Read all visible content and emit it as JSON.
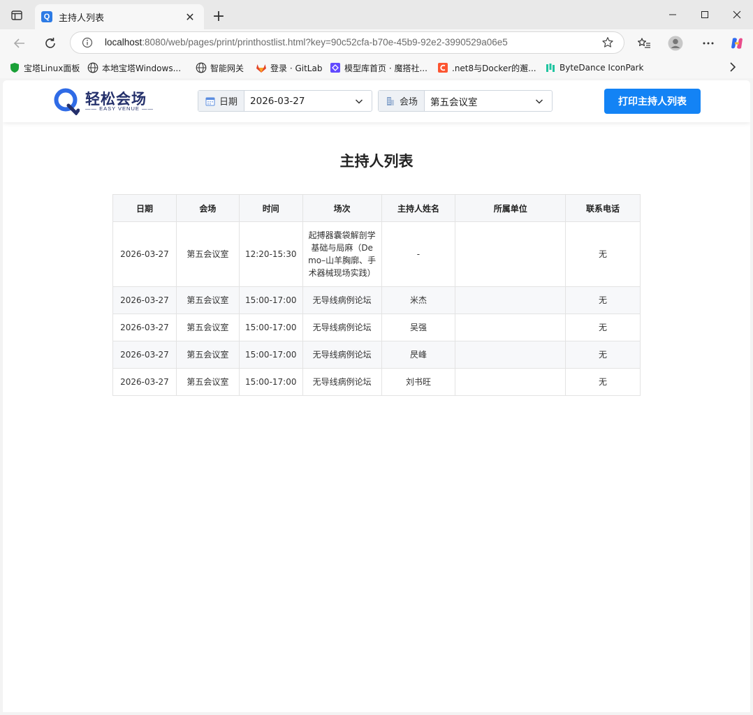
{
  "browser": {
    "tab_title": "主持人列表",
    "url_host": "localhost",
    "url_rest": ":8080/web/pages/print/printhostlist.html?key=90c52cfa-b70e-45b9-92e2-3990529a06e5",
    "bookmarks": [
      {
        "label": "宝塔Linux面板",
        "icon": "shield-icon"
      },
      {
        "label": "本地宝塔Windows...",
        "icon": "globe-icon"
      },
      {
        "label": "智能网关",
        "icon": "globe-icon"
      },
      {
        "label": "登录 · GitLab",
        "icon": "gitlab-icon"
      },
      {
        "label": "模型库首页 · 魔搭社...",
        "icon": "modelscope-icon"
      },
      {
        "label": ".net8与Docker的邂...",
        "icon": "csdn-icon"
      },
      {
        "label": "ByteDance IconPark",
        "icon": "iconpark-icon"
      }
    ]
  },
  "app": {
    "logo_text": "轻松会场",
    "logo_sub": "EASY VENUE",
    "date_label": "日期",
    "date_value": "2026-03-27",
    "venue_label": "会场",
    "venue_value": "第五会议室",
    "print_button": "打印主持人列表",
    "page_title": "主持人列表"
  },
  "table": {
    "headers": [
      "日期",
      "会场",
      "时间",
      "场次",
      "主持人姓名",
      "所属单位",
      "联系电话"
    ],
    "rows": [
      [
        "2026-03-27",
        "第五会议室",
        "12:20-15:30",
        "起搏器囊袋解剖学基础与局麻（Demo–山羊胸廓、手术器械现场实践）",
        "-",
        "",
        "无"
      ],
      [
        "2026-03-27",
        "第五会议室",
        "15:00-17:00",
        "无导线病例论坛",
        "米杰",
        "",
        "无"
      ],
      [
        "2026-03-27",
        "第五会议室",
        "15:00-17:00",
        "无导线病例论坛",
        "吴强",
        "",
        "无"
      ],
      [
        "2026-03-27",
        "第五会议室",
        "15:00-17:00",
        "无导线病例论坛",
        "昃峰",
        "",
        "无"
      ],
      [
        "2026-03-27",
        "第五会议室",
        "15:00-17:00",
        "无导线病例论坛",
        "刘书旺",
        "",
        "无"
      ]
    ]
  },
  "colors": {
    "primary": "#1383f5",
    "logo": "#24306b"
  }
}
